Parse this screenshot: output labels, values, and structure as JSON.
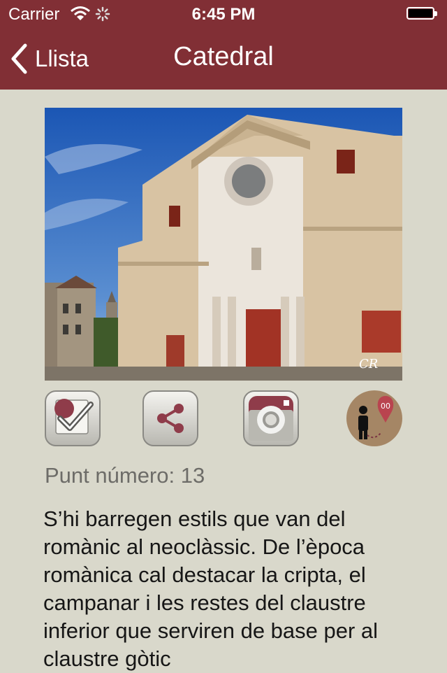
{
  "status_bar": {
    "carrier": "Carrier",
    "time": "6:45 PM"
  },
  "nav": {
    "back_label": "Llista",
    "title": "Catedral",
    "bar_color": "#812f35"
  },
  "actions": {
    "check_icon": "checkbox-check-icon",
    "share_icon": "share-icon",
    "camera_icon": "camera-icon",
    "map_icon": "person-map-pin-icon",
    "map_pin_label": "00"
  },
  "content": {
    "point_number": "Punt número: 13",
    "description": "S’hi barregen estils que van del romànic al neoclàssic. De l’època romànica cal destacar la cripta, el campanar i les restes del claustre inferior que serviren de base per al claustre gòtic",
    "photo_signature": "CR"
  },
  "colors": {
    "background": "#d9d8cb",
    "accent": "#812f35"
  }
}
